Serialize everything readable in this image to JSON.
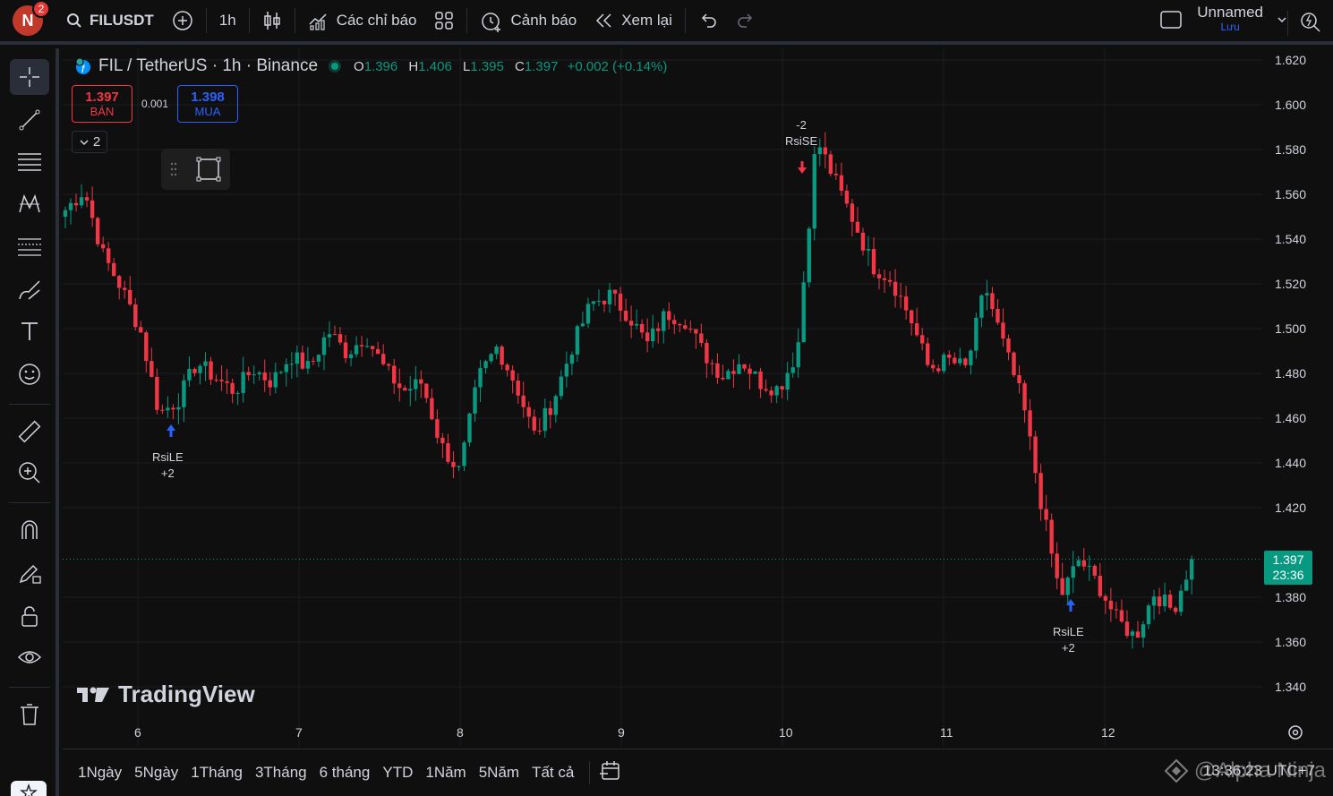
{
  "topbar": {
    "avatar_letter": "N",
    "notification_count": "2",
    "symbol": "FILUSDT",
    "interval": "1h",
    "indicators_label": "Các chỉ báo",
    "alerts_label": "Cảnh báo",
    "replay_label": "Xem lại",
    "layout_name": "Unnamed",
    "save_label": "Lưu"
  },
  "legend": {
    "title": "FIL / TetherUS · 1h · Binance",
    "o_label": "O",
    "o_value": "1.396",
    "h_label": "H",
    "h_value": "1.406",
    "l_label": "L",
    "l_value": "1.395",
    "c_label": "C",
    "c_value": "1.397",
    "change": "+0.002 (+0.14%)"
  },
  "trade": {
    "sell_price": "1.397",
    "sell_label": "BÁN",
    "spread": "0.001",
    "buy_price": "1.398",
    "buy_label": "MUA",
    "collapse_count": "2"
  },
  "signals": {
    "long1_name": "RsiLE",
    "long1_qty": "+2",
    "short_qty": "-2",
    "short_name": "RsiSE",
    "long2_name": "RsiLE",
    "long2_qty": "+2"
  },
  "price_axis": {
    "ticks": [
      "1.620",
      "1.600",
      "1.580",
      "1.560",
      "1.540",
      "1.520",
      "1.500",
      "1.480",
      "1.460",
      "1.440",
      "1.420",
      "1.380",
      "1.360",
      "1.340"
    ],
    "last_price": "1.397",
    "countdown": "23:36"
  },
  "time_axis": [
    "6",
    "7",
    "8",
    "9",
    "10",
    "11",
    "12"
  ],
  "branding": {
    "logo_text": "TradingView",
    "watermark": "@Alpha Ninja"
  },
  "bottombar": {
    "ranges": [
      "1Ngày",
      "5Ngày",
      "1Tháng",
      "3Tháng",
      "6 tháng",
      "YTD",
      "1Năm",
      "5Năm",
      "Tất cả"
    ],
    "clock": "13:36:23 UTC+7"
  },
  "colors": {
    "up": "#089981",
    "down": "#f23645",
    "accent": "#2962ff",
    "background": "#0f0f0f"
  },
  "chart_data": {
    "type": "candlestick",
    "symbol": "FILUSDT",
    "interval": "1h",
    "ylim": [
      1.33,
      1.625
    ],
    "x_tick_labels": [
      "6",
      "7",
      "8",
      "9",
      "10",
      "11",
      "12"
    ],
    "waypoints_close": [
      1.553,
      1.562,
      1.533,
      1.518,
      1.499,
      1.462,
      1.468,
      1.485,
      1.478,
      1.472,
      1.482,
      1.476,
      1.488,
      1.482,
      1.499,
      1.489,
      1.497,
      1.482,
      1.472,
      1.476,
      1.448,
      1.436,
      1.478,
      1.492,
      1.475,
      1.452,
      1.468,
      1.492,
      1.511,
      1.515,
      1.506,
      1.493,
      1.507,
      1.504,
      1.489,
      1.479,
      1.486,
      1.476,
      1.473,
      1.49,
      1.585,
      1.566,
      1.548,
      1.528,
      1.522,
      1.505,
      1.482,
      1.486,
      1.482,
      1.519,
      1.492,
      1.467,
      1.421,
      1.38,
      1.397,
      1.386,
      1.37,
      1.362,
      1.382,
      1.374,
      1.397
    ],
    "last": 1.397
  }
}
